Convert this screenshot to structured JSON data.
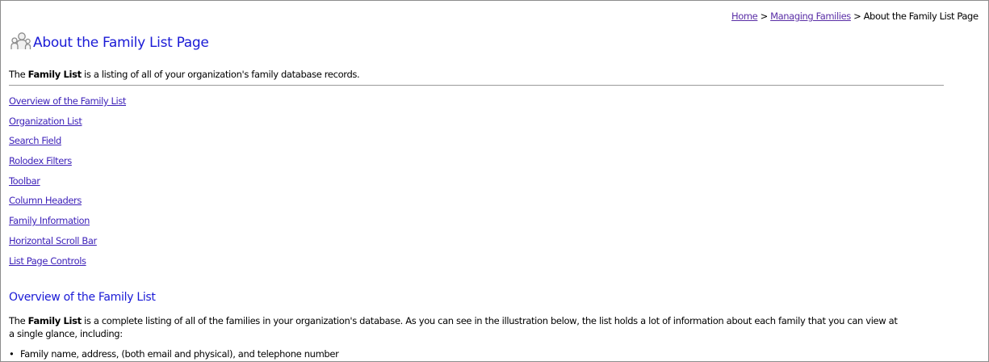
{
  "breadcrumb": {
    "home": "Home",
    "sep1": " > ",
    "managing_families": "Managing Families",
    "sep2": " > ",
    "current": "About the Family List Page"
  },
  "page": {
    "title": "About the Family List Page",
    "title_icon": "family-icon",
    "intro_prefix": "The ",
    "intro_bold": "Family List",
    "intro_suffix": " is a listing of all of your organization's family database records."
  },
  "toc": [
    "Overview of the Family List",
    "Organization List",
    "Search Field",
    "Rolodex Filters",
    "Toolbar",
    "Column Headers",
    "Family Information",
    "Horizontal Scroll Bar",
    "List Page Controls"
  ],
  "overview": {
    "heading": "Overview of the Family List",
    "para_prefix": "The ",
    "para_bold": "Family List",
    "para_suffix": " is a complete listing of all of the families in your organization's database. As you can see in the illustration below, the list holds a lot of information about each family that you can view at a single glance, including:",
    "bullets": [
      "Family name, address, (both email and physical), and telephone number"
    ]
  },
  "colors": {
    "heading": "#1a1ad6",
    "link": "#3b1fb8",
    "breadcrumb_link": "#5a2ea6",
    "rule": "#9a9a9a"
  }
}
